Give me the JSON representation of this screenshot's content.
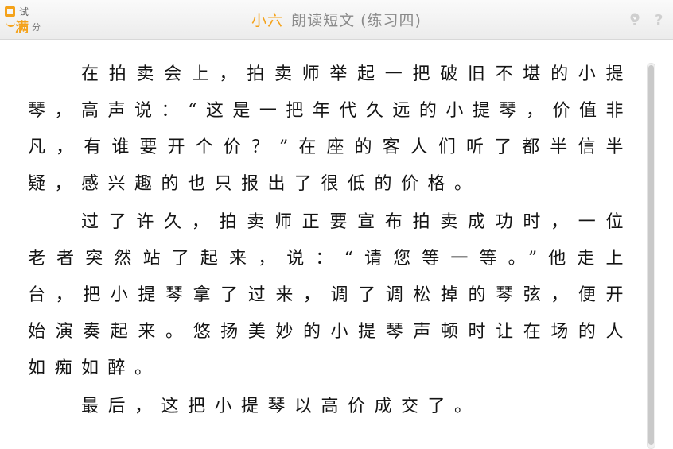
{
  "header": {
    "logo": {
      "line1": "试",
      "line2": "满",
      "line3": "分"
    },
    "grade": "小六",
    "lesson_title": "朗读短文 (练习四)",
    "hint_icon": "lightbulb-icon",
    "help_icon": "question-icon"
  },
  "passage": {
    "paragraphs": [
      "在拍卖会上，拍卖师举起一把破旧不堪的小提琴，高声说：“这是一把年代久远的小提琴，价值非凡，有谁要开个价？”在座的客人们听了都半信半疑，感兴趣的也只报出了很低的价格。",
      "过了许久，拍卖师正要宣布拍卖成功时，一位老者突然站了起来，说：“请您等一等。”他走上台，把小提琴拿了过来，调了调松掉的琴弦，便开始演奏起来。悠扬美妙的小提琴声顿时让在场的人如痴如醉。",
      "最后，这把小提琴以高价成交了。"
    ]
  },
  "colors": {
    "accent": "#f4a21a",
    "title_gray": "#8a8a8a",
    "text": "#141414"
  }
}
